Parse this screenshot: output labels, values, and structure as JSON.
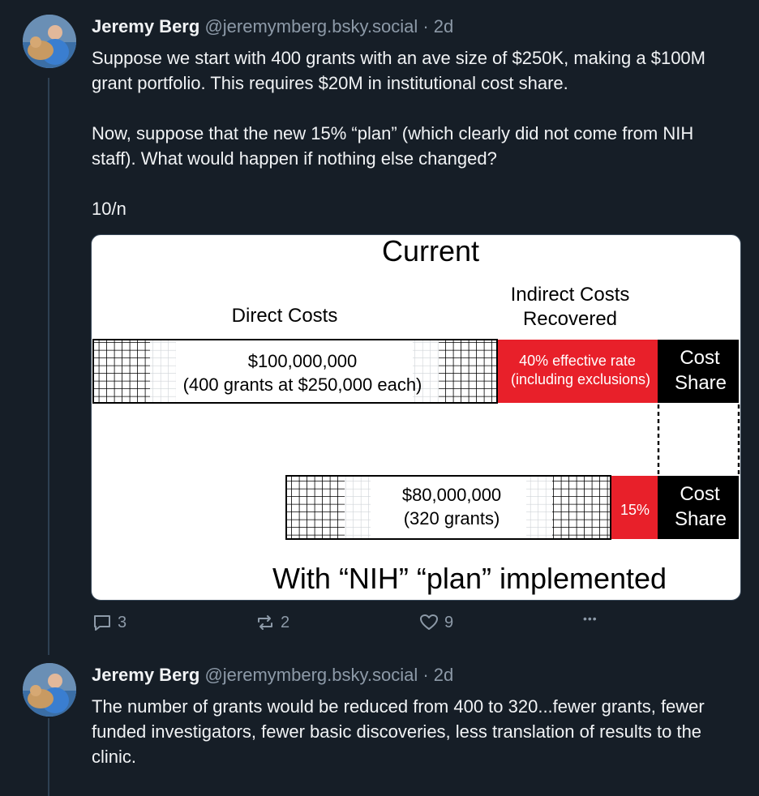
{
  "post1": {
    "author_name": "Jeremy Berg",
    "handle": "@jeremymberg.bsky.social",
    "separator": "·",
    "time": "2d",
    "paragraphs": [
      "Suppose we start with 400 grants with an ave size of $250K, making a $100M grant portfolio. This requires $20M in institutional cost share.",
      "Now, suppose that the new 15% “plan” (which clearly did not come from NIH staff). What would happen if nothing else changed?",
      "10/n"
    ],
    "image": {
      "title": "Current",
      "direct_costs_label": "Direct Costs",
      "indirect_label_1": "Indirect Costs",
      "indirect_label_2": "Recovered",
      "bar1_amount": "$100,000,000",
      "bar1_detail": "(400 grants at $250,000 each)",
      "bar1_rate_1": "40% effective rate",
      "bar1_rate_2": "(including exclusions)",
      "cost_share_1": "Cost",
      "cost_share_2": "Share",
      "bar2_amount": "$80,000,000",
      "bar2_detail": "(320 grants)",
      "bar2_rate": "15%",
      "caption": "With “NIH” “plan” implemented"
    },
    "actions": {
      "replies": "3",
      "reposts": "2",
      "likes": "9",
      "more": "•••"
    }
  },
  "post2": {
    "author_name": "Jeremy Berg",
    "handle": "@jeremymberg.bsky.social",
    "separator": "·",
    "time": "2d",
    "text": "The number of grants would be reduced from 400 to 320...fewer grants, fewer funded investigators, fewer basic discoveries, less translation of results to the clinic."
  },
  "colors": {
    "background": "#161e27",
    "thread_line": "#2e4052",
    "muted": "#8d9aa8",
    "red": "#e8202a"
  }
}
